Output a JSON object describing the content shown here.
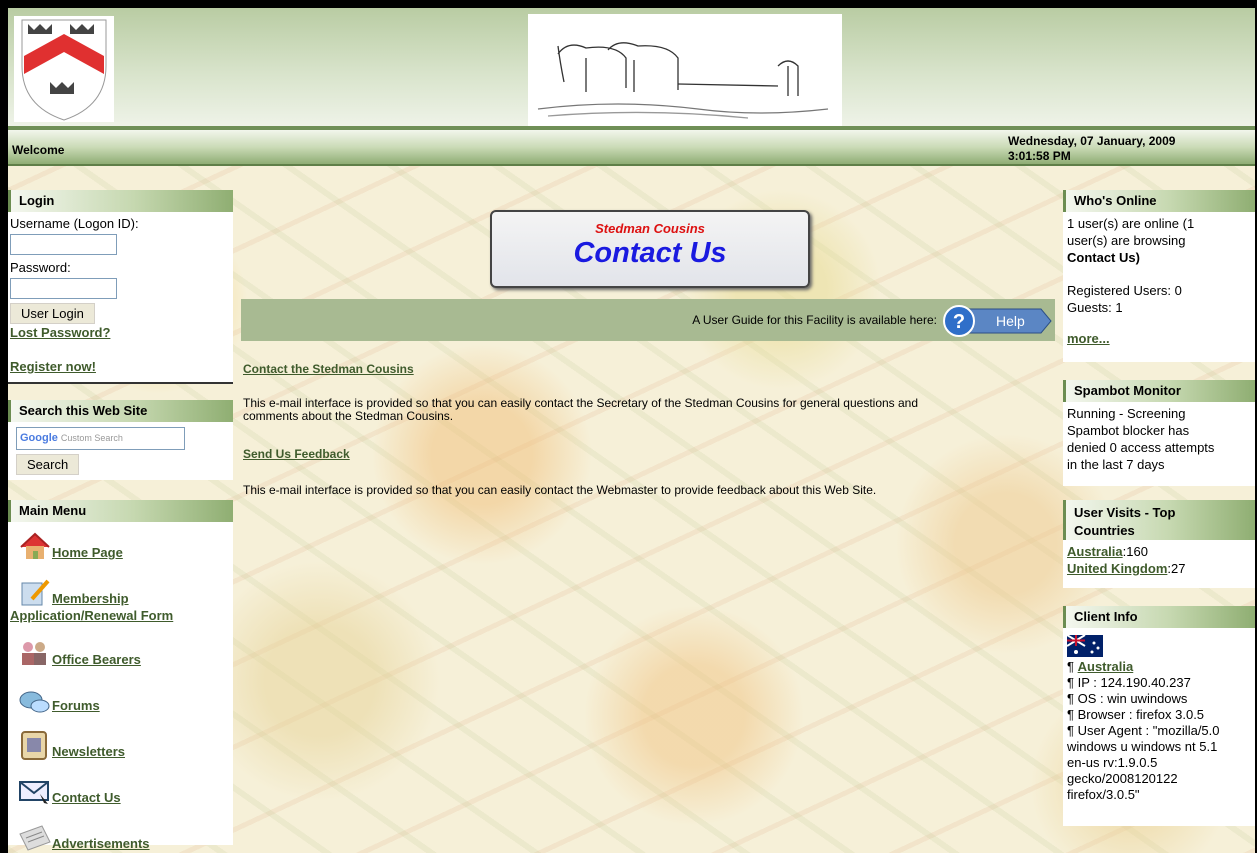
{
  "header": {
    "welcome": "Welcome",
    "date_line1": "Wednesday, 07 January, 2009",
    "date_line2": "3:01:58 PM"
  },
  "login": {
    "title": "Login",
    "username_label": "Username (Logon ID):",
    "password_label": "Password:",
    "login_button": "User Login",
    "lost_password": "Lost Password?",
    "register": "Register now!"
  },
  "search": {
    "title": "Search this Web Site",
    "placeholder": "Custom Search",
    "button": "Search"
  },
  "main_menu": {
    "title": "Main Menu",
    "items": [
      {
        "label": "Home Page",
        "icon": "house-icon"
      },
      {
        "label": "Membership",
        "label2": "Application/Renewal Form",
        "icon": "pencil-form-icon"
      },
      {
        "label": "Office Bearers",
        "icon": "people-icon"
      },
      {
        "label": "Forums",
        "icon": "speech-bubbles-icon"
      },
      {
        "label": "Newsletters",
        "icon": "newsletter-icon"
      },
      {
        "label": "Contact Us",
        "icon": "envelope-icon"
      },
      {
        "label": "Advertisements",
        "icon": "newspaper-icon"
      }
    ]
  },
  "content": {
    "banner_subtitle": "Stedman Cousins",
    "banner_title": "Contact Us",
    "guide_text": "A User Guide for this Facility is available here:",
    "help_button": "Help",
    "section1_link": "Contact the Stedman Cousins",
    "section1_text_line1": "This e-mail interface is provided so that you can easily contact the Secretary of the Stedman Cousins for general questions and",
    "section1_text_line2": "comments about the Stedman Cousins.",
    "section2_link": "Send Us Feedback",
    "section2_text": "This e-mail interface is provided so that you can easily contact the Webmaster to provide feedback about this Web Site."
  },
  "whos_online": {
    "title": "Who's Online",
    "line1": "1 user(s) are online (1",
    "line2": "user(s) are browsing",
    "line3": "Contact Us)",
    "registered": "Registered Users: 0",
    "guests": "Guests: 1",
    "more": "more..."
  },
  "spambot": {
    "title": "Spambot Monitor",
    "line1": "Running - Screening",
    "line2": "Spambot blocker has",
    "line3": "denied 0 access attempts",
    "line4": "in the last 7 days"
  },
  "user_visits": {
    "title_line1": "User Visits - Top",
    "title_line2": "Countries",
    "rows": [
      {
        "country": "Australia",
        "count": ":160"
      },
      {
        "country": "United Kingdom",
        "count": ":27"
      }
    ]
  },
  "client_info": {
    "title": "Client Info",
    "country": "Australia",
    "ip": "¶ IP : 124.190.40.237",
    "os": "¶ OS : win uwindows",
    "browser": "¶ Browser : firefox 3.0.5",
    "ua1": "¶ User Agent : \"mozilla/5.0",
    "ua2": "windows u windows nt 5.1",
    "ua3": "en-us rv:1.9.0.5",
    "ua4": "gecko/2008120122",
    "ua5": "firefox/3.0.5\""
  }
}
